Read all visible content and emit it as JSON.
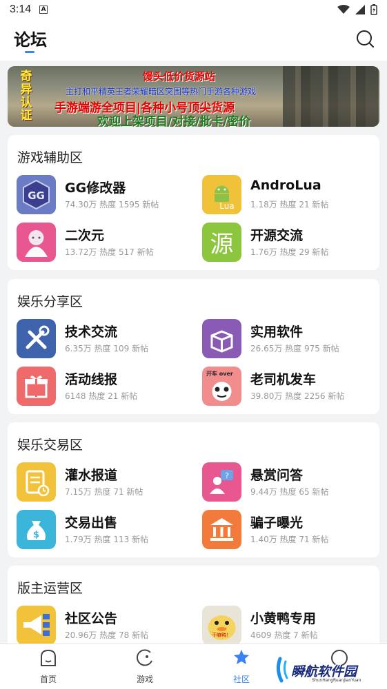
{
  "status_bar": {
    "time": "3:14",
    "badge": "A"
  },
  "header": {
    "title": "论坛"
  },
  "banner": {
    "side_text": "奇异认证",
    "line1": "馒头低价货源站",
    "line2": "主打和平精英王者荣耀暗区突围等热门手游各种游戏",
    "line3": "手游端游全项目|各种小号顶尖货源",
    "line4": "欢迎上架项目/对接/批卡/密价"
  },
  "sections": [
    {
      "title": "游戏辅助区",
      "items": [
        {
          "name": "GG修改器",
          "stats": "74.30万 热度 1595 新帖",
          "icon": "gg-icon"
        },
        {
          "name": "AndroLua",
          "stats": "1.18万 热度 21 新帖",
          "icon": "android-lua-icon"
        },
        {
          "name": "二次元",
          "stats": "13.72万 热度 517 新帖",
          "icon": "anime-girl-icon"
        },
        {
          "name": "开源交流",
          "stats": "1.76万 热度 29 新帖",
          "icon": "yuan-char-icon",
          "icon_text": "源"
        }
      ]
    },
    {
      "title": "娱乐分享区",
      "items": [
        {
          "name": "技术交流",
          "stats": "6.35万 热度 109 新帖",
          "icon": "tools-icon"
        },
        {
          "name": "实用软件",
          "stats": "26.65万 热度 975 新帖",
          "icon": "box-icon"
        },
        {
          "name": "活动线报",
          "stats": "6148 热度 21 新帖",
          "icon": "gift-icon"
        },
        {
          "name": "老司机发车",
          "stats": "39.80万 热度 2256 新帖",
          "icon": "panda-meme-icon",
          "icon_text": "开车 over"
        }
      ]
    },
    {
      "title": "娱乐交易区",
      "items": [
        {
          "name": "灌水报道",
          "stats": "7.15万 热度 71 新帖",
          "icon": "document-clock-icon"
        },
        {
          "name": "悬赏问答",
          "stats": "9.44万 热度 65 新帖",
          "icon": "question-user-icon"
        },
        {
          "name": "交易出售",
          "stats": "1.79万 热度 113 新帖",
          "icon": "money-bag-icon"
        },
        {
          "name": "骗子曝光",
          "stats": "1.40万 热度 71 新帖",
          "icon": "bank-icon"
        }
      ]
    },
    {
      "title": "版主运营区",
      "items": [
        {
          "name": "社区公告",
          "stats": "20.96万 热度 78 新帖",
          "icon": "megaphone-icon"
        },
        {
          "name": "小黄鸭专用",
          "stats": "4609 热度 7 新帖",
          "icon": "duck-icon",
          "icon_text": "干嘛鸭！"
        }
      ]
    }
  ],
  "nav": [
    {
      "label": "首页",
      "icon": "home-icon"
    },
    {
      "label": "游戏",
      "icon": "game-icon"
    },
    {
      "label": "社区",
      "icon": "community-icon",
      "active": true
    },
    {
      "label": "",
      "icon": "profile-icon"
    }
  ],
  "watermark": {
    "text": "瞬航软件园",
    "sub": "ShunHangRuanJianYuan"
  },
  "colors": {
    "accent": "#3b82f6"
  }
}
